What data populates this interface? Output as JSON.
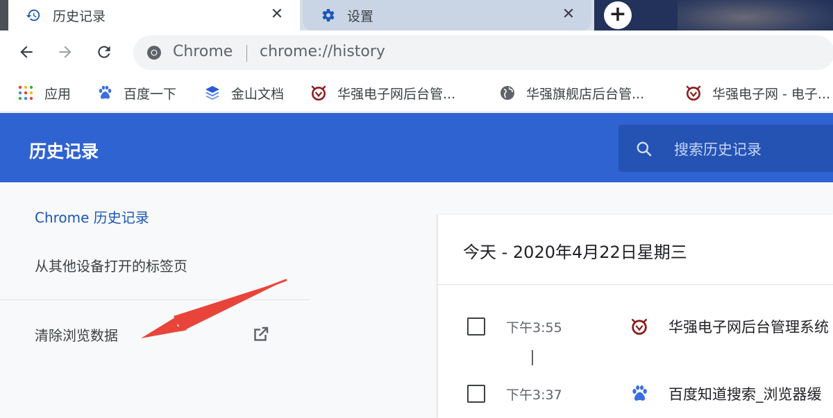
{
  "tabs": [
    {
      "title": "历史记录",
      "icon": "history-icon",
      "active": true
    },
    {
      "title": "设置",
      "icon": "gear-icon",
      "active": false
    }
  ],
  "toolbar": {
    "omnibox_app": "Chrome",
    "omnibox_url": "chrome://history"
  },
  "bookmarks": [
    {
      "label": "应用",
      "icon": "apps-grid-icon"
    },
    {
      "label": "百度一下",
      "icon": "baidu-paw-icon"
    },
    {
      "label": "金山文档",
      "icon": "kdocs-icon"
    },
    {
      "label": "华强电子网后台管...",
      "icon": "huaqiang-icon"
    },
    {
      "label": "华强旗舰店后台管...",
      "icon": "globe-icon"
    },
    {
      "label": "华强电子网 - 电子...",
      "icon": "huaqiang-icon"
    }
  ],
  "header": {
    "title": "历史记录",
    "search_placeholder": "搜索历史记录"
  },
  "sidebar": {
    "items": [
      {
        "label": "Chrome 历史记录",
        "selected": true
      },
      {
        "label": "从其他设备打开的标签页",
        "selected": false
      },
      {
        "label": "清除浏览数据",
        "selected": false
      }
    ]
  },
  "history": {
    "date_heading": "今天 - 2020年4月22日星期三",
    "entries": [
      {
        "time": "下午3:55",
        "title": "华强电子网后台管理系统",
        "icon": "huaqiang-icon"
      },
      {
        "time": "下午3:37",
        "title": "百度知道搜索_浏览器缓",
        "icon": "baidu-paw-icon"
      }
    ]
  },
  "colors": {
    "header_blue": "#2f63d1",
    "search_blue": "#2553b4",
    "sidebar_link_blue": "#1a56b8",
    "annotation_red": "#e8443a"
  }
}
